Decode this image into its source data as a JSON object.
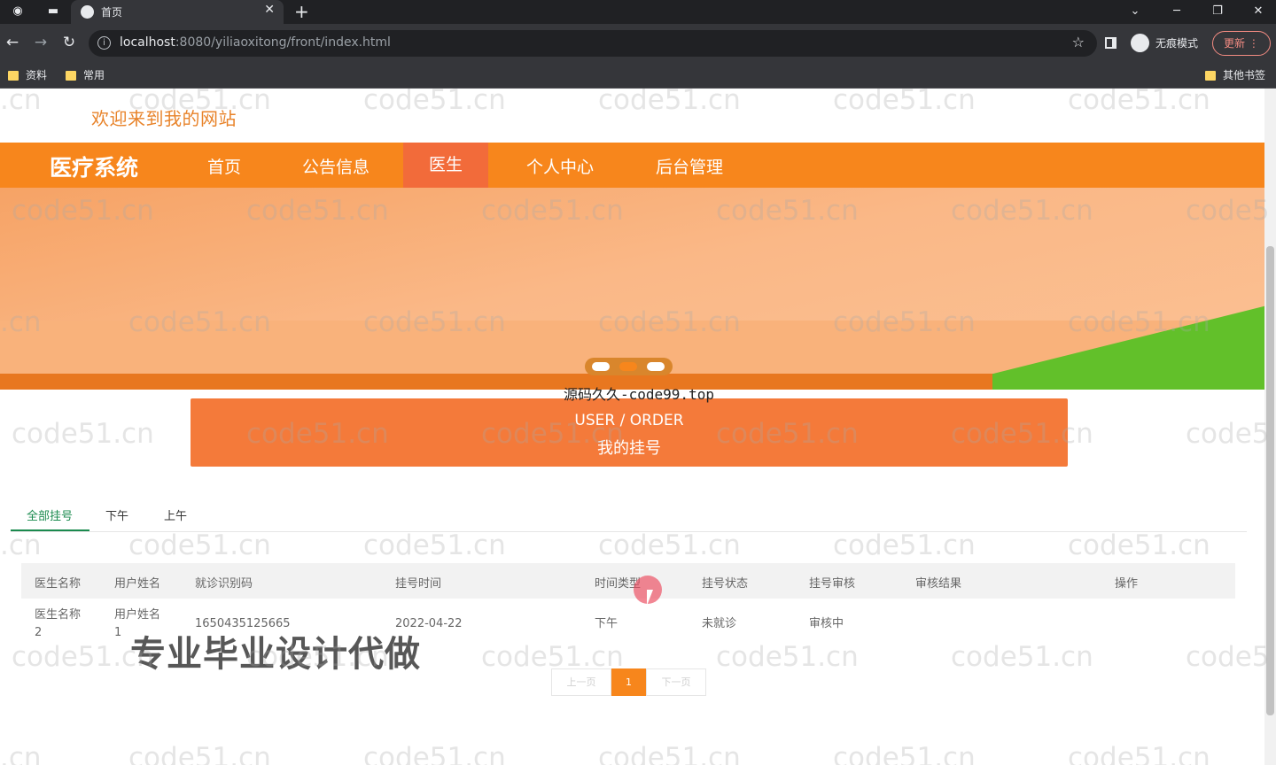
{
  "browser": {
    "tab_title": "首页",
    "url_host": "localhost",
    "url_rest": ":8080/yiliaoxitong/front/index.html",
    "incognito_label": "无痕模式",
    "update_label": "更新",
    "bookmarks": [
      "资料",
      "常用"
    ],
    "other_bookmarks": "其他书签"
  },
  "site": {
    "welcome": "欢迎来到我的网站",
    "brand": "医疗系统",
    "nav": [
      {
        "label": "首页",
        "active": false
      },
      {
        "label": "公告信息",
        "active": false
      },
      {
        "label": "医生",
        "active": true
      },
      {
        "label": "个人中心",
        "active": false
      },
      {
        "label": "后台管理",
        "active": false
      }
    ],
    "banner_overlay": "源码久久-code99.top",
    "section": {
      "en": "USER / ORDER",
      "zh": "我的挂号"
    },
    "filter_tabs": [
      {
        "label": "全部挂号",
        "active": true
      },
      {
        "label": "下午",
        "active": false
      },
      {
        "label": "上午",
        "active": false
      }
    ],
    "table": {
      "headers": [
        "医生名称",
        "用户姓名",
        "就诊识别码",
        "挂号时间",
        "时间类型",
        "挂号状态",
        "挂号审核",
        "审核结果",
        "操作"
      ],
      "rows": [
        {
          "doctor_line1": "医生名称",
          "doctor_line2": "2",
          "user_line1": "用户姓名",
          "user_line2": "1",
          "code": "1650435125665",
          "time": "2022-04-22",
          "time_type": "下午",
          "status": "未就诊",
          "review": "审核中",
          "result": "",
          "action": ""
        }
      ]
    },
    "pager": {
      "prev": "上一页",
      "current": "1",
      "next": "下一页"
    },
    "ad_text": "专业毕业设计代做",
    "watermark": "code51.cn",
    "watermark_partial_left": ".cn",
    "watermark_partial_right": "code5"
  },
  "colors": {
    "primary": "#f7861c",
    "active_nav": "#f26b3a",
    "section_bg": "#f47a3a",
    "active_tab": "#1a8a4e"
  }
}
